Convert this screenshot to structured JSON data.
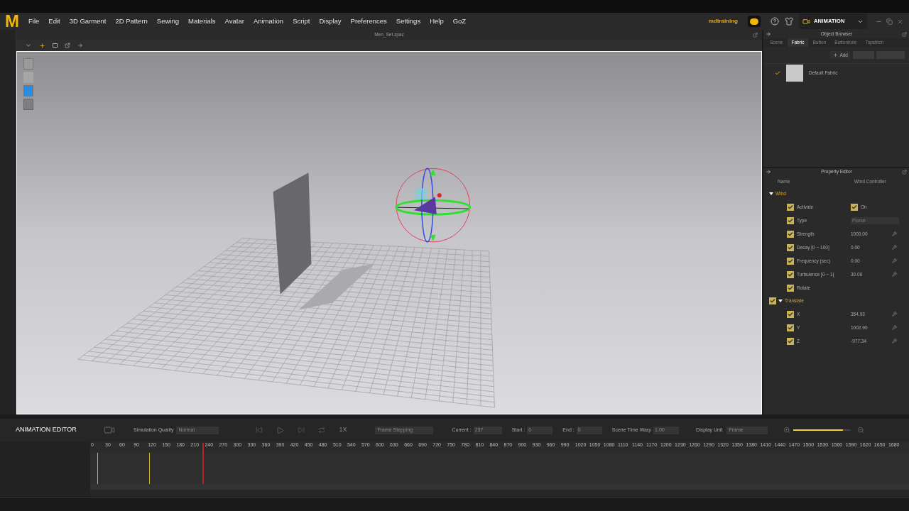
{
  "logo": "M",
  "menu": [
    "File",
    "Edit",
    "3D Garment",
    "2D Pattern",
    "Sewing",
    "Materials",
    "Avatar",
    "Animation",
    "Script",
    "Display",
    "Preferences",
    "Settings",
    "Help",
    "GoZ"
  ],
  "user": "mdtraining",
  "mode": "ANIMATION",
  "file_name": "Men_Set.zpac",
  "object_browser": {
    "title": "Object Browser",
    "tabs": [
      {
        "label": "Scene",
        "selected": false
      },
      {
        "label": "Fabric",
        "selected": true
      },
      {
        "label": "Button",
        "selected": false
      },
      {
        "label": "Buttonhole",
        "selected": false
      },
      {
        "label": "Topstitch",
        "selected": false
      }
    ],
    "add_button": "Add",
    "fabrics": [
      {
        "name": "Default Fabric",
        "checked": true
      }
    ]
  },
  "property_editor": {
    "title": "Property Editor",
    "name_label": "Name",
    "name_value": "Wind Controller",
    "sections": [
      {
        "title": "Wind",
        "kind": "plain",
        "expanded": true,
        "rows": [
          {
            "kind": "toggle",
            "label": "Activate",
            "checked": true,
            "value": "On"
          },
          {
            "kind": "dropdown",
            "label": "Type",
            "checked": true,
            "value": "Planar"
          },
          {
            "kind": "number",
            "label": "Strength",
            "checked": true,
            "value": "1000.00"
          },
          {
            "kind": "number",
            "label": "Decay [0 ~ 100]",
            "checked": true,
            "value": "0.00"
          },
          {
            "kind": "number",
            "label": "Frequency (sec)",
            "checked": true,
            "value": "0.00"
          },
          {
            "kind": "number",
            "label": "Turbulence [0 ~ 1(",
            "checked": true,
            "value": "30.00"
          },
          {
            "kind": "empty",
            "label": "Rotate",
            "checked": true
          }
        ]
      },
      {
        "title": "Translate",
        "kind": "checkable",
        "checked": true,
        "expanded": true,
        "rows": [
          {
            "kind": "number",
            "label": "X",
            "checked": true,
            "value": "354.93"
          },
          {
            "kind": "number",
            "label": "Y",
            "checked": true,
            "value": "1002.90"
          },
          {
            "kind": "number",
            "label": "Z",
            "checked": true,
            "value": "-977.34"
          }
        ]
      }
    ]
  },
  "animation_editor": {
    "title": "ANIMATION EDITOR",
    "quality_label": "Simulation Quality",
    "quality_value": "Normal",
    "speed": "1X",
    "playback_mode": "Frame Stepping",
    "current_label": "Current :",
    "current": "237",
    "start_label": "Start :",
    "start": "0",
    "end_label": "End :",
    "end": "0",
    "warp_label": "Scene Time Warp",
    "warp": "1.00",
    "unit_label": "Display Unit",
    "unit": "Frame",
    "zoom": {
      "level": 0.87
    },
    "ticks": [
      "0",
      "30",
      "60",
      "90",
      "120",
      "150",
      "180",
      "210",
      "240",
      "270",
      "300",
      "330",
      "360",
      "390",
      "420",
      "450",
      "480",
      "510",
      "540",
      "570",
      "600",
      "630",
      "660",
      "690",
      "720",
      "750",
      "780",
      "810",
      "840",
      "870",
      "900",
      "930",
      "960",
      "990",
      "1020",
      "1050",
      "1080",
      "1110",
      "1140",
      "1170",
      "1200",
      "1230",
      "1260",
      "1290",
      "1320",
      "1350",
      "1380",
      "1410",
      "1440",
      "1470",
      "1500",
      "1530",
      "1560",
      "1590",
      "1620",
      "1650",
      "1680"
    ],
    "keys": [
      {
        "level": 0.009
      },
      {
        "level": 0.074
      }
    ]
  }
}
